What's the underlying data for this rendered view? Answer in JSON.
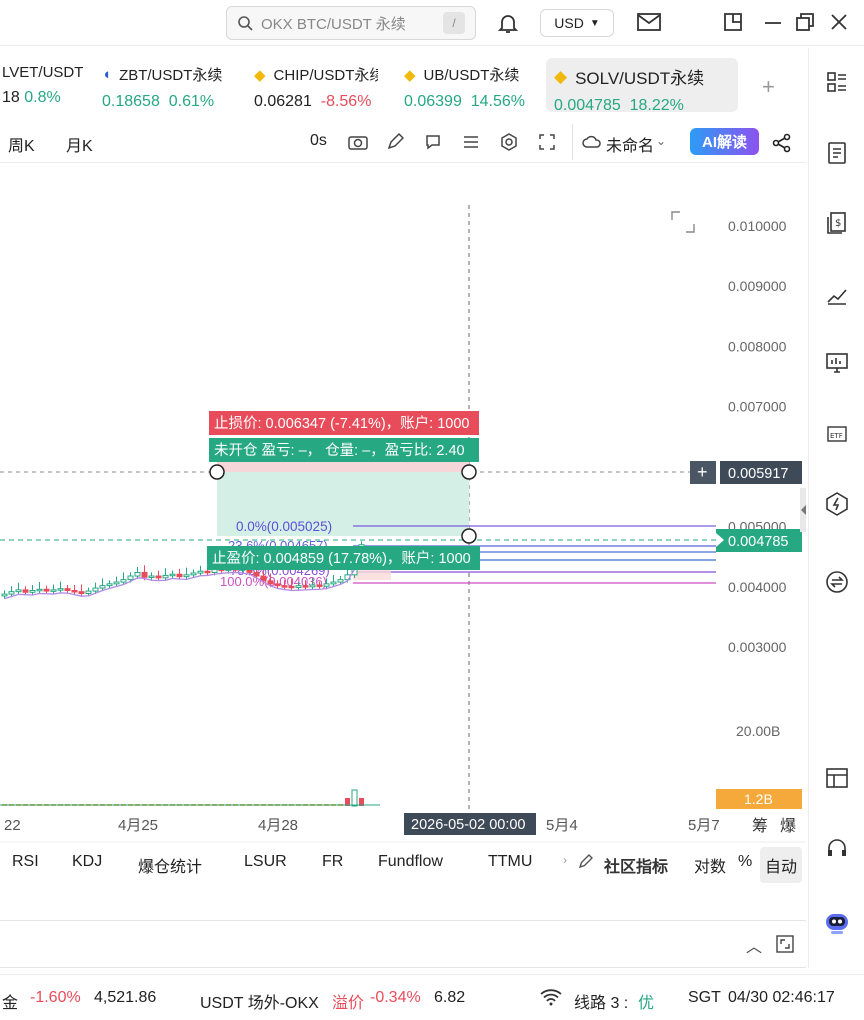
{
  "search": {
    "placeholder": "OKX BTC/USDT 永续",
    "shortcut": "/"
  },
  "currency": "USD",
  "tickers": [
    {
      "name": "LVET/USDT",
      "price": "18",
      "change": "0.8%",
      "dir": "up"
    },
    {
      "name": "ZBT/USDT永续",
      "price": "0.18658",
      "change": "0.61%",
      "dir": "up"
    },
    {
      "name": "CHIP/USDT永续",
      "price": "0.06281",
      "change": "-8.56%",
      "dir": "down"
    },
    {
      "name": "UB/USDT永续",
      "price": "0.06399",
      "change": "14.56%",
      "dir": "up"
    },
    {
      "name": "SOLV/USDT永续",
      "price": "0.004785",
      "change": "18.22%",
      "dir": "up"
    }
  ],
  "toolbar": {
    "week": "周K",
    "month": "月K",
    "countdown": "0s",
    "layout_name": "未命名",
    "ai_button": "AI解读"
  },
  "chart": {
    "stop_loss_label": "止损价: 0.006347 (-7.41%)，账户: 1000",
    "position_label": "未开仓  盈亏: –，  仓量: –，盈亏比: 2.40",
    "take_profit_label": "止盈价: 0.004859 (17.78%)，账户: 1000",
    "fib_top": "0.0%(0.005025)",
    "fib_mid": "23.6%(0.004657)",
    "fib_low1": "78.6%(0.004269)",
    "fib_low2": "100.0%(0.004036)",
    "crosshair_price": "0.005917",
    "current_price": "0.004785",
    "volume_axis": "20.00B",
    "volume_badge": "1.2B",
    "date_label": "2026-05-02 00:00"
  },
  "chart_data": {
    "type": "candlestick",
    "y_ticks": [
      "0.010000",
      "0.009000",
      "0.008000",
      "0.007000",
      "0.005000",
      "0.004000",
      "0.003000"
    ],
    "x_ticks": [
      "22",
      "4月25",
      "4月28",
      "5月4",
      "5月7"
    ],
    "ylim": [
      0.0027,
      0.0106
    ],
    "current_price": 0.004785,
    "ma_color": "#b48ae6",
    "up_color": "#26a883",
    "down_color": "#e84c5a"
  },
  "axis_buttons": {
    "chip": "筹",
    "liq": "爆"
  },
  "indicators": [
    "RSI",
    "KDJ",
    "爆仓统计",
    "LSUR",
    "FR",
    "Fundflow",
    "TTMU"
  ],
  "community_indicators": "社区指标",
  "scale_buttons": {
    "log": "对数",
    "percent": "%",
    "auto": "自动"
  },
  "status": {
    "gold_label": "金",
    "gold_change": "-1.60%",
    "gold_price": "4,521.86",
    "otc_label": "USDT 场外-OKX",
    "premium_label": "溢价",
    "premium_value": "-0.34%",
    "otc_price": "6.82",
    "line_label": "线路 3 :",
    "line_quality": "优",
    "timezone": "SGT",
    "datetime": "04/30 02:46:17"
  }
}
